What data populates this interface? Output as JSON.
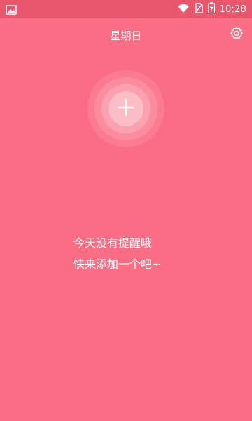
{
  "status_bar": {
    "time": "10:28",
    "icons": [
      "image-icon",
      "wifi-icon",
      "no-sim-icon",
      "battery-charging-icon"
    ]
  },
  "header": {
    "title": "星期日",
    "settings_icon": "gear-icon"
  },
  "add_button": {
    "icon": "plus-icon"
  },
  "empty_state": {
    "line1": "今天没有提醒哦",
    "line2": "快来添加一个吧~"
  },
  "colors": {
    "background": "#fb6d84",
    "status_bar": "#e9576d",
    "text": "#ffffff"
  }
}
